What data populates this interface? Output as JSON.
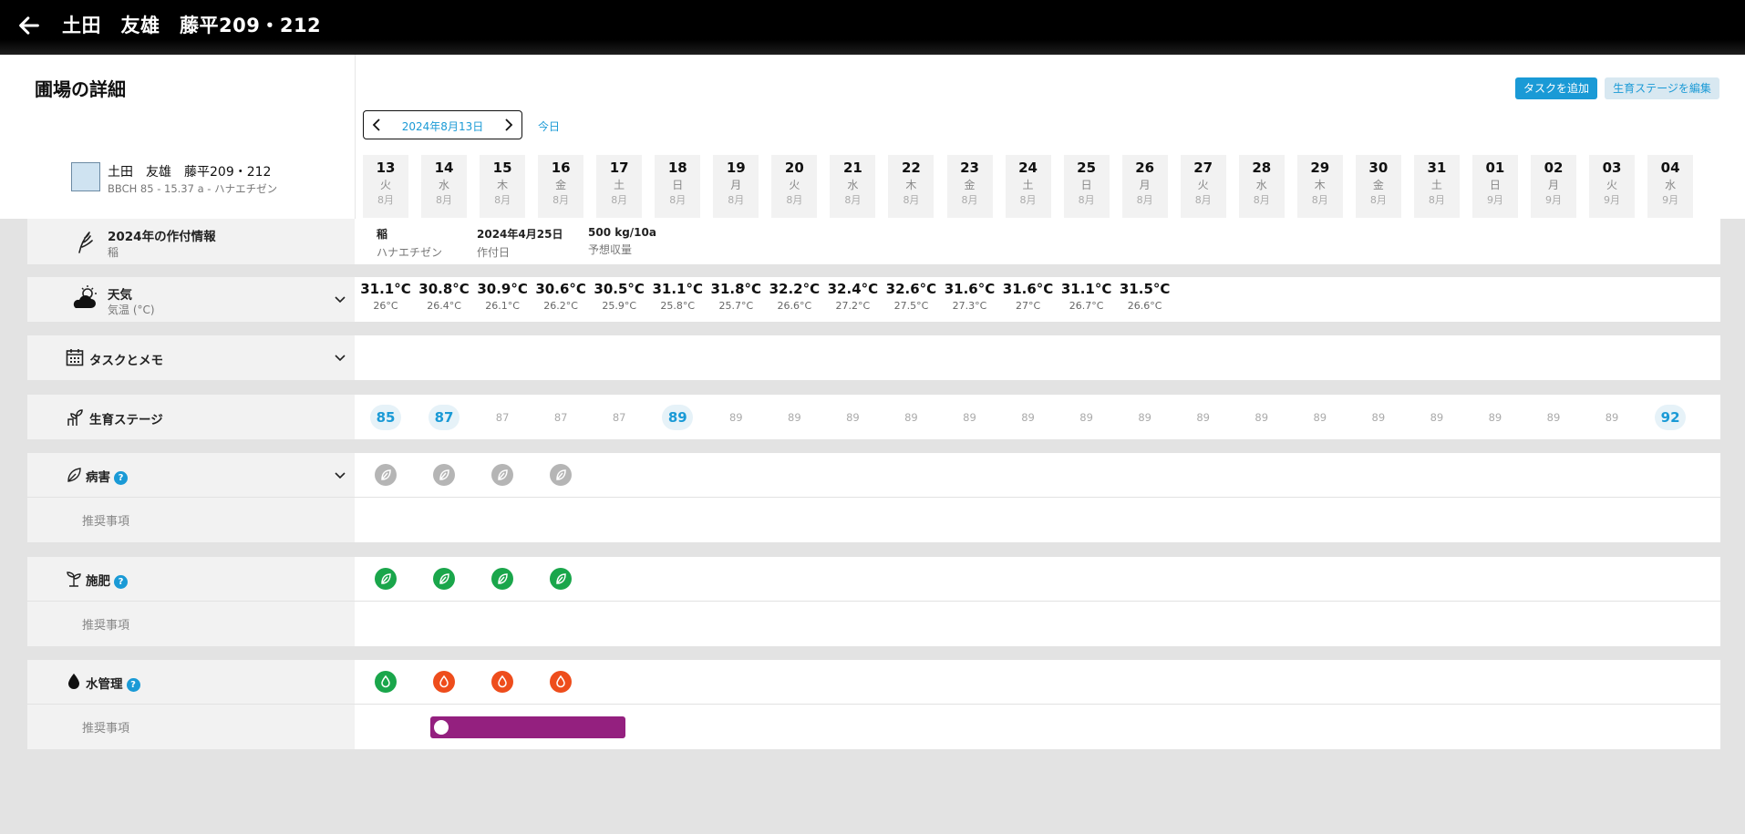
{
  "header": {
    "title": "土田　友雄　藤平209・212"
  },
  "page": {
    "title": "圃場の詳細",
    "field": {
      "name": "土田　友雄　藤平209・212",
      "subtitle": "BBCH 85 - 15.37 a - ハナエチゼン"
    },
    "date_nav": {
      "current": "2024年8月13日",
      "today": "今日"
    },
    "buttons": {
      "add_task": "タスクを追加",
      "edit_stage": "生育ステージを編集"
    }
  },
  "days": [
    {
      "d": "13",
      "w": "火",
      "m": "8月"
    },
    {
      "d": "14",
      "w": "水",
      "m": "8月"
    },
    {
      "d": "15",
      "w": "木",
      "m": "8月"
    },
    {
      "d": "16",
      "w": "金",
      "m": "8月"
    },
    {
      "d": "17",
      "w": "土",
      "m": "8月"
    },
    {
      "d": "18",
      "w": "日",
      "m": "8月"
    },
    {
      "d": "19",
      "w": "月",
      "m": "8月"
    },
    {
      "d": "20",
      "w": "火",
      "m": "8月"
    },
    {
      "d": "21",
      "w": "水",
      "m": "8月"
    },
    {
      "d": "22",
      "w": "木",
      "m": "8月"
    },
    {
      "d": "23",
      "w": "金",
      "m": "8月"
    },
    {
      "d": "24",
      "w": "土",
      "m": "8月"
    },
    {
      "d": "25",
      "w": "日",
      "m": "8月"
    },
    {
      "d": "26",
      "w": "月",
      "m": "8月"
    },
    {
      "d": "27",
      "w": "火",
      "m": "8月"
    },
    {
      "d": "28",
      "w": "水",
      "m": "8月"
    },
    {
      "d": "29",
      "w": "木",
      "m": "8月"
    },
    {
      "d": "30",
      "w": "金",
      "m": "8月"
    },
    {
      "d": "31",
      "w": "土",
      "m": "8月"
    },
    {
      "d": "01",
      "w": "日",
      "m": "9月"
    },
    {
      "d": "02",
      "w": "月",
      "m": "9月"
    },
    {
      "d": "03",
      "w": "火",
      "m": "9月"
    },
    {
      "d": "04",
      "w": "水",
      "m": "9月"
    }
  ],
  "crop_info": {
    "label": "2024年の作付情報",
    "sublabel": "稲",
    "items": [
      {
        "main": "稲",
        "sub": "ハナエチゼン"
      },
      {
        "main": "2024年4月25日",
        "sub": "作付日"
      },
      {
        "main": "500 kg/10a",
        "sub": "予想収量"
      }
    ]
  },
  "weather": {
    "label": "天気",
    "sublabel": "気温 (°C)",
    "days": [
      {
        "hi": "31.1°C",
        "lo": "26°C"
      },
      {
        "hi": "30.8°C",
        "lo": "26.4°C"
      },
      {
        "hi": "30.9°C",
        "lo": "26.1°C"
      },
      {
        "hi": "30.6°C",
        "lo": "26.2°C"
      },
      {
        "hi": "30.5°C",
        "lo": "25.9°C"
      },
      {
        "hi": "31.1°C",
        "lo": "25.8°C"
      },
      {
        "hi": "31.8°C",
        "lo": "25.7°C"
      },
      {
        "hi": "32.2°C",
        "lo": "26.6°C"
      },
      {
        "hi": "32.4°C",
        "lo": "27.2°C"
      },
      {
        "hi": "32.6°C",
        "lo": "27.5°C"
      },
      {
        "hi": "31.6°C",
        "lo": "27.3°C"
      },
      {
        "hi": "31.6°C",
        "lo": "27°C"
      },
      {
        "hi": "31.1°C",
        "lo": "26.7°C"
      },
      {
        "hi": "31.5°C",
        "lo": "26.6°C"
      }
    ]
  },
  "tasks": {
    "label": "タスクとメモ"
  },
  "growth_stage": {
    "label": "生育ステージ",
    "values": [
      {
        "v": "85",
        "hl": true
      },
      {
        "v": "87",
        "hl": true
      },
      {
        "v": "87",
        "hl": false
      },
      {
        "v": "87",
        "hl": false
      },
      {
        "v": "87",
        "hl": false
      },
      {
        "v": "89",
        "hl": true
      },
      {
        "v": "89",
        "hl": false
      },
      {
        "v": "89",
        "hl": false
      },
      {
        "v": "89",
        "hl": false
      },
      {
        "v": "89",
        "hl": false
      },
      {
        "v": "89",
        "hl": false
      },
      {
        "v": "89",
        "hl": false
      },
      {
        "v": "89",
        "hl": false
      },
      {
        "v": "89",
        "hl": false
      },
      {
        "v": "89",
        "hl": false
      },
      {
        "v": "89",
        "hl": false
      },
      {
        "v": "89",
        "hl": false
      },
      {
        "v": "89",
        "hl": false
      },
      {
        "v": "89",
        "hl": false
      },
      {
        "v": "89",
        "hl": false
      },
      {
        "v": "89",
        "hl": false
      },
      {
        "v": "89",
        "hl": false
      },
      {
        "v": "92",
        "hl": true
      }
    ]
  },
  "disease": {
    "label": "病害",
    "help": "?",
    "reco": "推奨事項",
    "color": "#b5b5b5",
    "icon": "leaf-icon",
    "days": 4
  },
  "fertilizer": {
    "label": "施肥",
    "help": "?",
    "reco": "推奨事項",
    "color": "#1aa64b",
    "icon": "sprout-icon",
    "days": 4
  },
  "water": {
    "label": "水管理",
    "help": "?",
    "reco": "推奨事項",
    "colors": [
      "#1aa64b",
      "#ee4d1c",
      "#ee4d1c",
      "#ee4d1c"
    ],
    "icon": "water-drop-icon",
    "bar_color": "#94207f"
  }
}
